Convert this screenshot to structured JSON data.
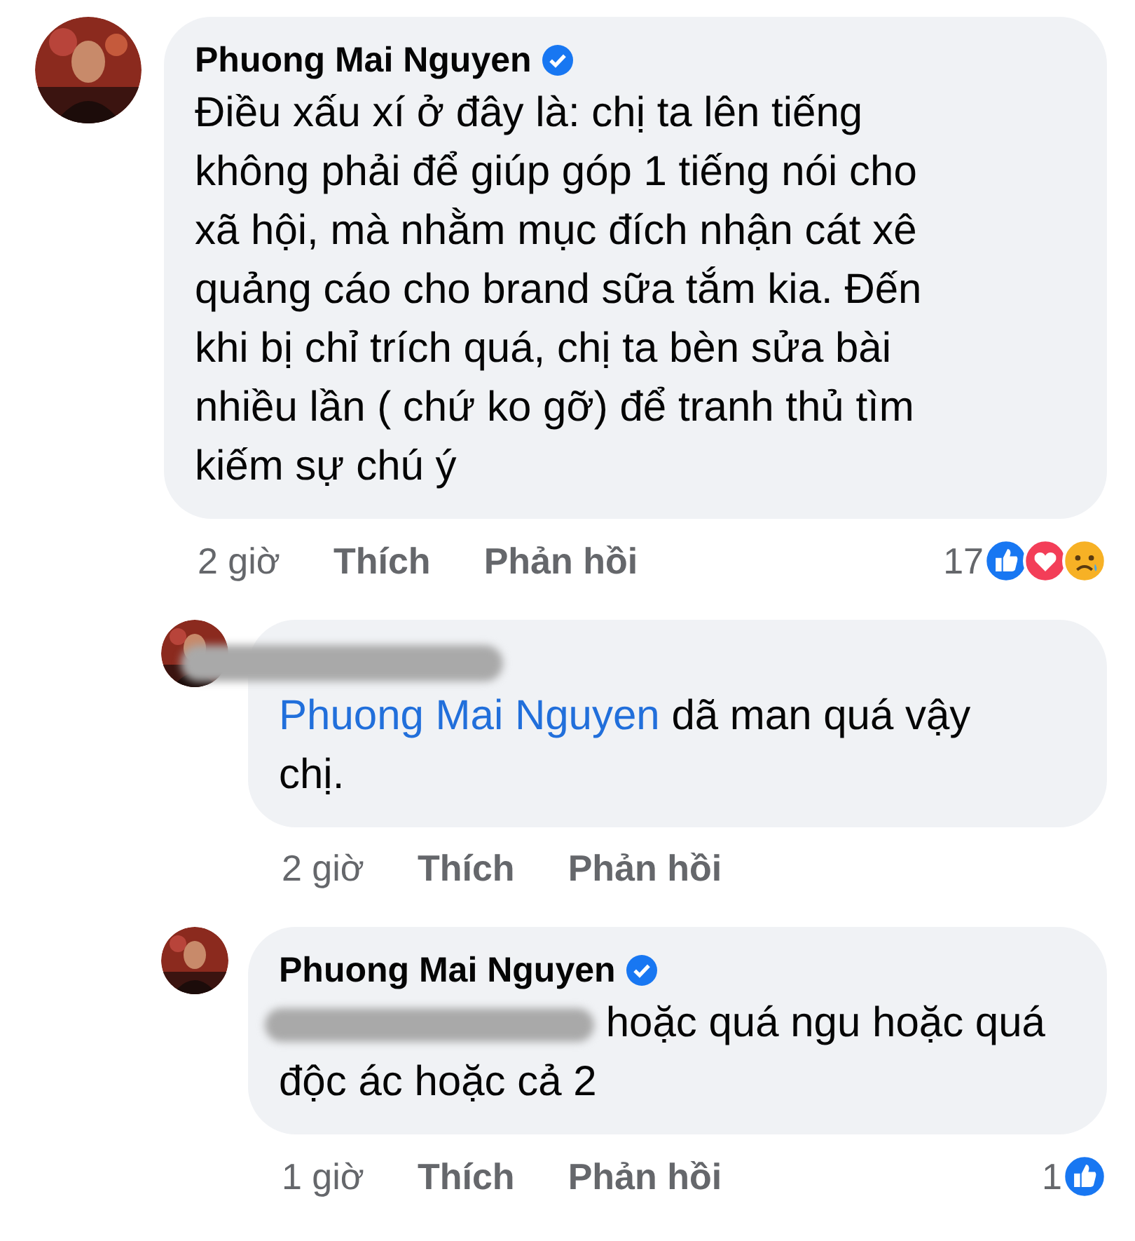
{
  "comments": [
    {
      "author": {
        "name": "Phuong Mai Nguyen",
        "verified": true,
        "redacted": false
      },
      "text": "Điều xấu xí ở đây là: chị ta lên tiếng không phải để giúp góp 1 tiếng nói cho xã hội, mà nhằm mục đích nhận cát xê quảng cáo cho brand sữa tắm kia. Đến khi bị chỉ trích quá, chị ta bèn sửa bài nhiều lần ( chứ ko gỡ) để tranh thủ tìm kiếm sự chú ý",
      "time": "2 giờ",
      "like": "Thích",
      "reply": "Phản hồi",
      "reaction_count": "17",
      "reactions": [
        {
          "kind": "like"
        },
        {
          "kind": "love"
        },
        {
          "kind": "sad"
        }
      ],
      "children": [
        {
          "author": {
            "redacted": true
          },
          "mention": {
            "name": "Phuong Mai Nguyen",
            "redacted": false
          },
          "text": "dã man quá vậy chị.",
          "time": "2 giờ",
          "like": "Thích",
          "reply": "Phản hồi"
        },
        {
          "author": {
            "name": "Phuong Mai Nguyen",
            "verified": true,
            "redacted": false
          },
          "mention": {
            "redacted": true
          },
          "text": "hoặc quá ngu hoặc quá độc ác hoặc cả 2",
          "time": "1 giờ",
          "like": "Thích",
          "reply": "Phản hồi",
          "reaction_count": "1",
          "reactions": [
            {
              "kind": "like"
            }
          ]
        }
      ]
    }
  ]
}
